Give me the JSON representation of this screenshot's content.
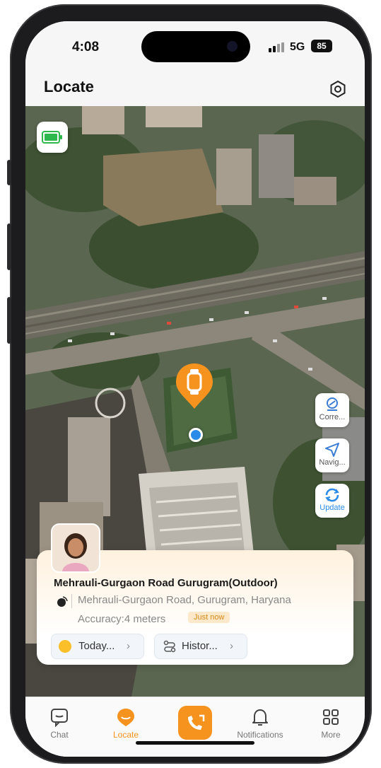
{
  "status_bar": {
    "time": "4:08",
    "network": "5G",
    "battery": "85"
  },
  "header": {
    "title": "Locate",
    "settings_icon": "settings-hexagon-icon"
  },
  "map_controls": [
    {
      "label": "Corre...",
      "icon": "correct-location-icon"
    },
    {
      "label": "Navig...",
      "icon": "navigation-arrow-icon"
    },
    {
      "label": "Update",
      "icon": "refresh-icon"
    }
  ],
  "location_card": {
    "title": "Mehrauli-Gurgaon Road Gurugram(Outdoor)",
    "address": "Mehrauli-Gurgaon Road, Gurugram, Haryana",
    "accuracy": "Accuracy:4 meters",
    "badge": "Just now",
    "today_chip": "Today...",
    "history_chip": "Histor..."
  },
  "tabs": [
    {
      "label": "Chat",
      "icon": "chat-icon"
    },
    {
      "label": "Locate",
      "icon": "locate-icon",
      "active": true
    },
    {
      "label": "",
      "icon": "video-call-icon"
    },
    {
      "label": "Notifications",
      "icon": "bell-icon"
    },
    {
      "label": "More",
      "icon": "grid-icon"
    }
  ],
  "colors": {
    "accent": "#f5931e",
    "card_bg": "#fff1de",
    "badge_bg": "#fde8c9",
    "update_blue": "#2a8ce8"
  }
}
